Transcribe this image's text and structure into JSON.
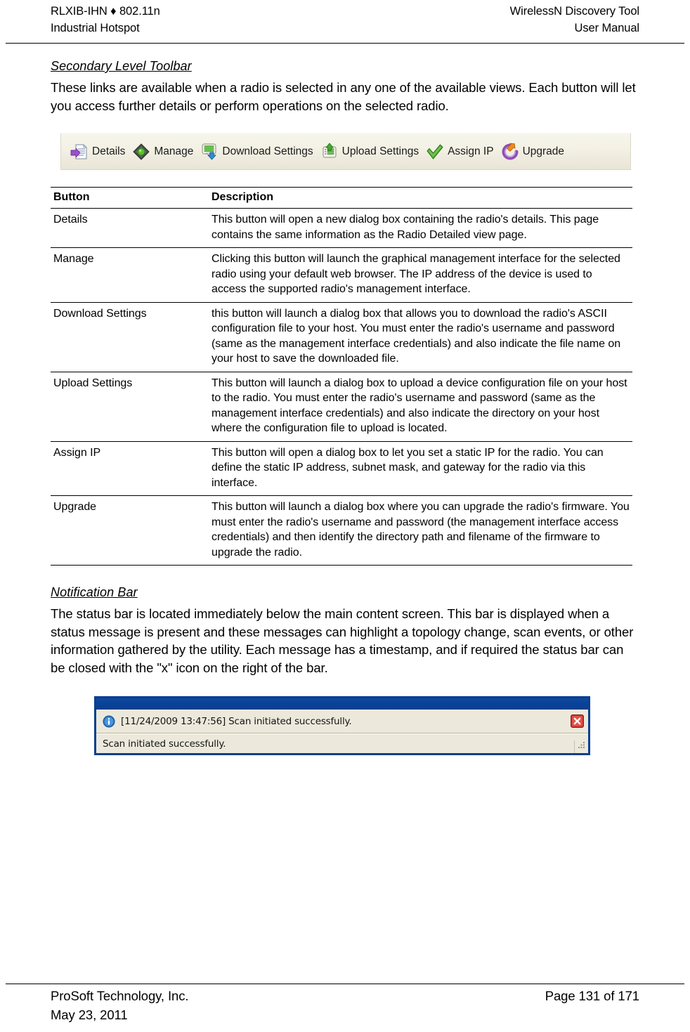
{
  "header": {
    "left_line1": "RLXIB-IHN ♦ 802.11n",
    "left_line2": "Industrial Hotspot",
    "right_line1": "WirelessN Discovery Tool",
    "right_line2": "User Manual"
  },
  "sections": {
    "toolbar": {
      "heading": "Secondary Level Toolbar",
      "paragraph": "These links are available when a radio is selected in any one of the available views. Each button will let you access further details or perform operations on the selected radio."
    },
    "notification": {
      "heading": "Notification Bar",
      "paragraph": "The status bar is located immediately below the main content screen. This bar is displayed when a status message is present and these messages can highlight a topology change, scan events, or other information gathered by the utility. Each message has a timestamp, and if required the status bar can be closed with the \"x\" icon on the right of the bar."
    }
  },
  "toolbar_figure": {
    "items": [
      {
        "label": "Details",
        "icon": "details-page-arrow-icon"
      },
      {
        "label": "Manage",
        "icon": "manage-gem-icon"
      },
      {
        "label": "Download Settings",
        "icon": "download-settings-icon"
      },
      {
        "label": "Upload Settings",
        "icon": "upload-settings-icon"
      },
      {
        "label": "Assign IP",
        "icon": "assign-ip-checkmark-icon"
      },
      {
        "label": "Upgrade",
        "icon": "upgrade-refresh-icon"
      }
    ]
  },
  "table": {
    "columns": [
      "Button",
      "Description"
    ],
    "rows": [
      {
        "button": "Details",
        "description": "This button will open a new dialog box containing the radio's details. This page contains the same information as the Radio Detailed view page."
      },
      {
        "button": "Manage",
        "description": "Clicking this button will launch the graphical management interface for the selected radio using your default web browser. The IP address of the device is used to access the supported radio's management interface."
      },
      {
        "button": "Download Settings",
        "description": "this button will launch a dialog box that allows you to download the radio's ASCII configuration file to your host. You must enter the radio's username and password (same as the management interface credentials) and also indicate the file name on your host to save the downloaded file."
      },
      {
        "button": "Upload Settings",
        "description": "This button will launch a dialog box to upload a device configuration file on your host to the radio. You must enter the radio's username and password (same as the management interface credentials) and also indicate the directory on your host where the configuration file to upload is located."
      },
      {
        "button": "Assign IP",
        "description": "This button will open a dialog box to let you set a static IP for the radio. You can define the static IP address, subnet mask, and gateway for the radio via this interface."
      },
      {
        "button": "Upgrade",
        "description": "This button will launch a dialog box where you can upgrade the radio's firmware. You must enter the radio's username and password (the management interface access credentials) and then identify the directory path and filename of the firmware to upgrade the radio."
      }
    ]
  },
  "notification_figure": {
    "message": "[11/24/2009 13:47:56] Scan initiated successfully.",
    "status": "Scan initiated successfully.",
    "info_icon": "info-icon",
    "close_icon": "close-icon",
    "titlebar_color": "#0b3f8f",
    "body_color": "#ece9dc",
    "close_color": "#c9312b"
  },
  "footer": {
    "left_line1": "ProSoft Technology, Inc.",
    "left_line2": "May 23, 2011",
    "right_line1": "Page 131 of 171"
  }
}
